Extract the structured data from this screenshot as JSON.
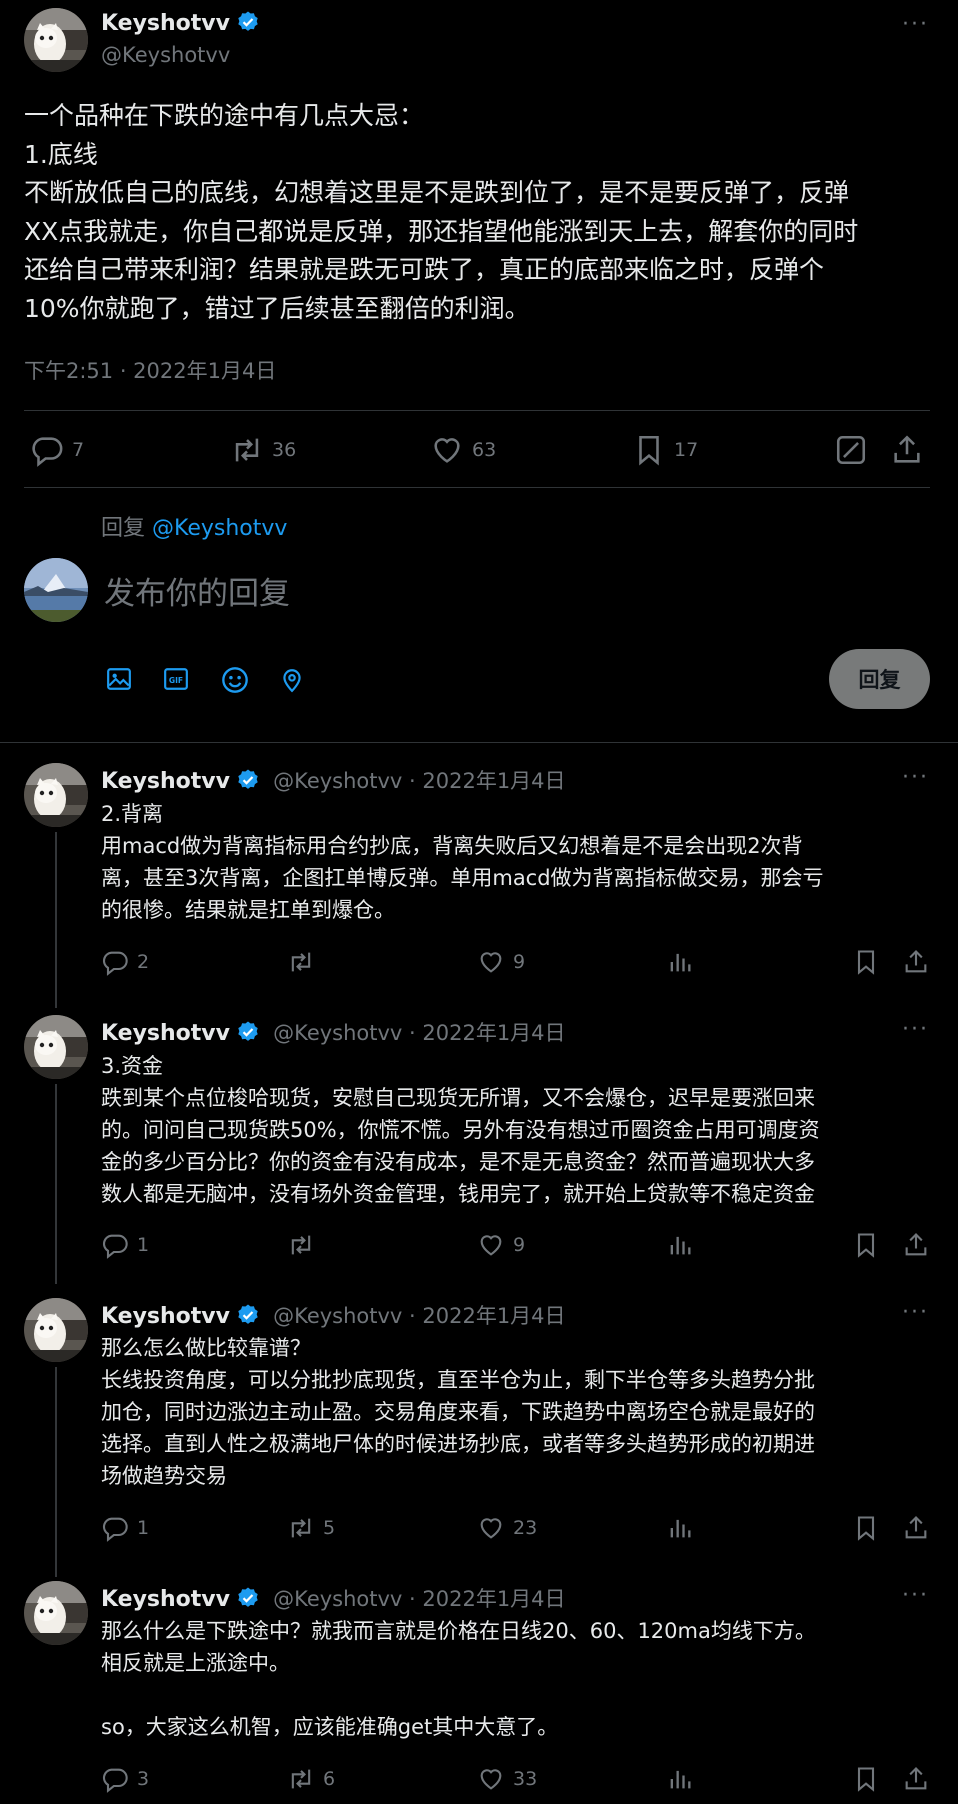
{
  "main_tweet": {
    "name": "Keyshotvv",
    "handle": "@Keyshotvv",
    "lines": [
      "一个品种在下跌的途中有几点大忌：",
      "1.底线",
      "不断放低自己的底线，幻想着这里是不是跌到位了，是不是要反弹了，反弹",
      "XX点我就走，你自己都说是反弹，那还指望他能涨到天上去，解套你的同时",
      "还给自己带来利润？结果就是跌无可跌了，真正的底部来临之时，反弹个",
      "10%你就跑了，错过了后续甚至翻倍的利润。"
    ],
    "timestamp": "下午2:51 · 2022年1月4日",
    "stats": {
      "replies": "7",
      "retweets": "36",
      "likes": "63",
      "bookmarks": "17"
    }
  },
  "composer": {
    "replying_prefix": "回复",
    "replying_to": "@Keyshotvv",
    "placeholder": "发布你的回复",
    "reply_button": "回复",
    "tool_icons": [
      "image-icon",
      "gif-icon",
      "emoji-icon",
      "location-icon"
    ]
  },
  "replies": [
    {
      "name": "Keyshotvv",
      "handle": "@Keyshotvv · 2022年1月4日",
      "lines": [
        "2.背离",
        "用macd做为背离指标用合约抄底，背离失败后又幻想着是不是会出现2次背",
        "离，甚至3次背离，企图扛单博反弹。单用macd做为背离指标做交易，那会亏",
        "的很惨。结果就是扛单到爆仓。"
      ],
      "replies": "2",
      "retweets": "",
      "likes": "9"
    },
    {
      "name": "Keyshotvv",
      "handle": "@Keyshotvv · 2022年1月4日",
      "lines": [
        "3.资金",
        "跌到某个点位梭哈现货，安慰自己现货无所谓，又不会爆仓，迟早是要涨回来",
        "的。问问自己现货跌50%，你慌不慌。另外有没有想过币圈资金占用可调度资",
        "金的多少百分比？你的资金有没有成本，是不是无息资金？然而普遍现状大多",
        "数人都是无脑冲，没有场外资金管理，钱用完了，就开始上贷款等不稳定资金"
      ],
      "replies": "1",
      "retweets": "",
      "likes": "9"
    },
    {
      "name": "Keyshotvv",
      "handle": "@Keyshotvv · 2022年1月4日",
      "lines": [
        "那么怎么做比较靠谱？",
        "长线投资角度，可以分批抄底现货，直至半仓为止，剩下半仓等多头趋势分批",
        "加仓，同时边涨边主动止盈。交易角度来看，下跌趋势中离场空仓就是最好的",
        "选择。直到人性之极满地尸体的时候进场抄底，或者等多头趋势形成的初期进",
        "场做趋势交易"
      ],
      "replies": "1",
      "retweets": "5",
      "likes": "23"
    },
    {
      "name": "Keyshotvv",
      "handle": "@Keyshotvv · 2022年1月4日",
      "lines": [
        "那么什么是下跌途中？就我而言就是价格在日线20、60、120ma均线下方。",
        "相反就是上涨途中。",
        "",
        "so，大家这么机智，应该能准确get其中大意了。"
      ],
      "replies": "3",
      "retweets": "6",
      "likes": "33"
    }
  ],
  "colors": {
    "accent": "#1d9bf0",
    "background": "#000000",
    "muted": "#71767b",
    "verified": "#1d9bf0"
  }
}
